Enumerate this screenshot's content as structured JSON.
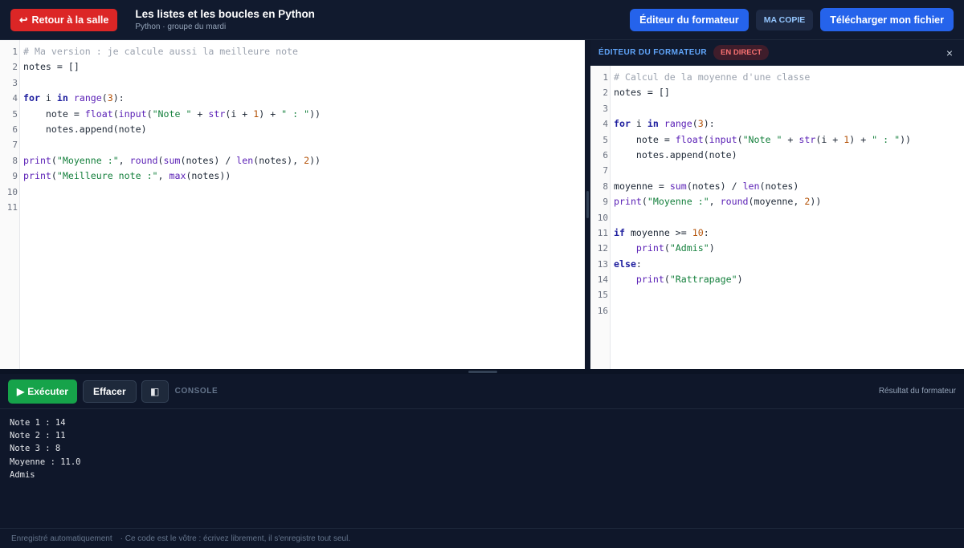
{
  "header": {
    "back_label": "Retour à la salle",
    "back_icon": "↩",
    "title": "Les listes et les boucles en Python",
    "subtitle": "Python · groupe du mardi",
    "trainer_editor_label": "Éditeur du formateur",
    "copy_badge": "MA COPIE",
    "download_label": "Télécharger mon fichier"
  },
  "left_editor": {
    "line_numbers": [
      "1",
      "2",
      "3",
      "4",
      "5",
      "6",
      "7",
      "8",
      "9",
      "10",
      "11"
    ]
  },
  "right_panel": {
    "title": "ÉDITEUR DU FORMATEUR",
    "live_badge": "EN DIRECT",
    "close_icon": "×",
    "line_numbers": [
      "1",
      "2",
      "3",
      "4",
      "5",
      "6",
      "7",
      "8",
      "9",
      "10",
      "11",
      "12",
      "13",
      "14",
      "15",
      "16"
    ]
  },
  "console": {
    "run_label": "Exécuter",
    "run_icon": "▶",
    "clear_label": "Effacer",
    "panel_icon": "◧",
    "label": "CONSOLE",
    "right_label": "Résultat du formateur",
    "output": [
      "Note 1 : 14",
      "Note 2 : 11",
      "Note 3 : 8",
      "Moyenne : 11.0",
      "Admis"
    ]
  },
  "footer": {
    "saved": "Enregistré automatiquement",
    "note": "· Ce code est le vôtre : écrivez librement, il s'enregistre tout seul."
  },
  "colors": {
    "back_button": "#dc2626",
    "primary": "#2563eb",
    "run_button": "#16a34a",
    "live_badge": "#f87171",
    "background": "#0f172a"
  },
  "icons": [
    "undo-arrow-icon",
    "play-icon",
    "panel-toggle-icon",
    "close-icon"
  ]
}
